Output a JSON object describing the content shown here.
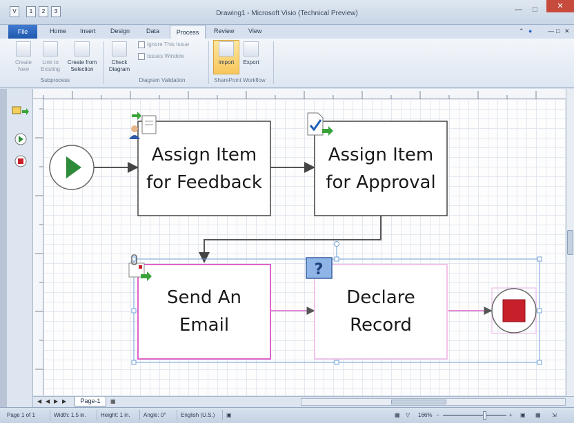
{
  "window": {
    "title": "Drawing1 - Microsoft Visio (Technical Preview)",
    "quick_access": [
      "1",
      "2",
      "3"
    ]
  },
  "ribbon": {
    "file_label": "File",
    "tabs": [
      "Home",
      "Insert",
      "Design",
      "Data",
      "Process",
      "Review",
      "View"
    ],
    "active_tab": "Process",
    "subprocess": {
      "create_new": "Create New",
      "link_existing": "Link to Existing",
      "create_from_selection": "Create from Selection",
      "group_label": "Subprocess"
    },
    "validation": {
      "check_diagram": "Check Diagram",
      "ignore_rule": "Ignore This Issue",
      "issues_window": "Issues Window",
      "group_label": "Diagram Validation"
    },
    "sharepoint": {
      "import": "Import",
      "export": "Export",
      "group_label": "SharePoint Workflow"
    }
  },
  "diagram": {
    "assign_feedback": [
      "Assign Item",
      "for Feedback"
    ],
    "assign_approval": [
      "Assign Item",
      "for Approval"
    ],
    "send_email": [
      "Send An",
      "Email"
    ],
    "declare_record": [
      "Declare",
      "Record"
    ],
    "question_mark": "?"
  },
  "colors": {
    "start_green": "#2e8b3a",
    "stop_red": "#c8202a",
    "selection_blue": "#6fa0d8",
    "selected_shape": "#e064c8",
    "ribbon_highlight": "#f8c65c"
  },
  "page_tabs": {
    "page_label": "Page-1"
  },
  "status": {
    "page": "Page 1 of 1",
    "width": "Width: 1.5 in.",
    "height": "Height: 1 in.",
    "angle": "Angle: 0°",
    "language": "English (U.S.)",
    "zoom": "166%"
  }
}
